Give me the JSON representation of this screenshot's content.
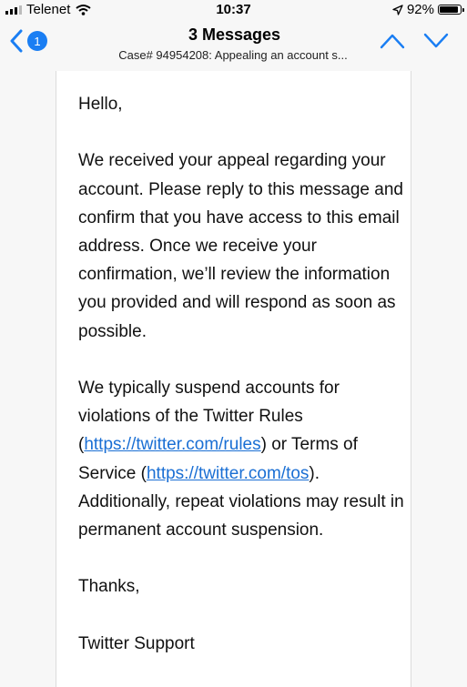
{
  "status_bar": {
    "carrier": "Telenet",
    "time": "10:37",
    "battery_percent": "92%",
    "battery_level": 0.92,
    "icons": [
      "signal-icon",
      "wifi-icon",
      "location-arrow-icon",
      "battery-icon"
    ]
  },
  "nav": {
    "back_badge_count": "1",
    "title": "3 Messages",
    "subtitle": "Case# 94954208: Appealing an account s...",
    "icons": [
      "back-chevron-icon",
      "previous-message-icon",
      "next-message-icon"
    ]
  },
  "message": {
    "greeting": "Hello,",
    "paragraph1": "We received your appeal regarding your account. Please reply to this message and confirm that you have access to this email address. Once we receive your confirmation, we’ll review the information you provided and will respond as soon as possible.",
    "paragraph2": {
      "text_a": "We typically suspend accounts for violations of the Twitter Rules (",
      "link_rules": "https://twitter.com/rules",
      "text_b": ") or Terms of Service (",
      "link_tos": "https://twitter.com/tos",
      "text_c": "). Additionally, repeat violations may result in permanent account suspension."
    },
    "thanks": "Thanks,",
    "signature": "Twitter Support"
  },
  "colors": {
    "accent": "#1a7ef3",
    "link": "#1a6fd4"
  }
}
